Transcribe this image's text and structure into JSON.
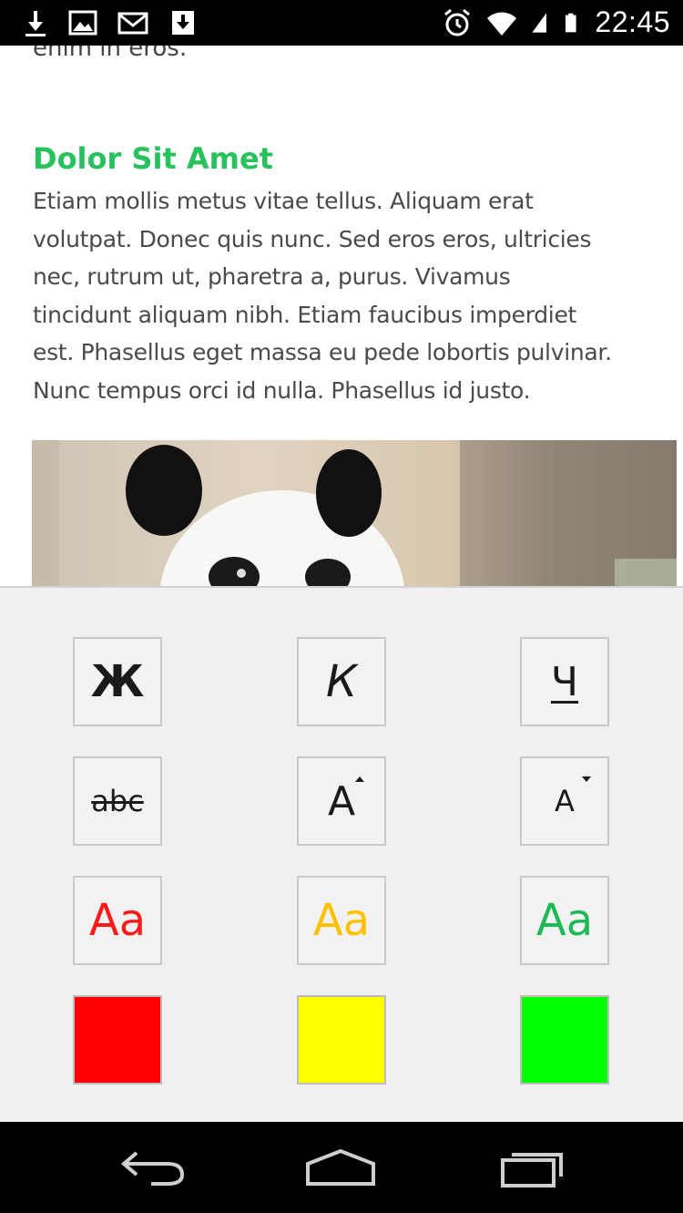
{
  "status_bar": {
    "time": "22:45",
    "left_icons": [
      "download-icon",
      "image-icon",
      "mail-icon",
      "file-download-icon"
    ],
    "right_icons": [
      "alarm-icon",
      "wifi-icon",
      "signal-icon",
      "battery-icon"
    ]
  },
  "article": {
    "cut_text": "enim in eros.",
    "heading": "Dolor Sit Amet",
    "heading_color": "#27c25d",
    "body_lines": [
      "Etiam mollis metus vitae tellus. Aliquam erat",
      "volutpat. Donec quis nunc. Sed eros eros, ultricies",
      "nec, rutrum ut, pharetra a, purus. Vivamus",
      "tincidunt aliquam nibh. Etiam faucibus imperdiet",
      "est. Phasellus eget massa eu pede lobortis pulvinar.",
      "Nunc tempus orci id nulla. Phasellus id justo."
    ]
  },
  "format_panel": {
    "bold_label": "Ж",
    "italic_label": "К",
    "underline_label": "Ч",
    "strike_label": "abc",
    "grow_label": "A",
    "shrink_label": "A",
    "text_color_label": "Aa",
    "colors": {
      "red": "#ff0000",
      "yellow": "#ffff00",
      "green": "#00ff00",
      "text_red": "#ff1a1a",
      "text_yellow": "#ffc000",
      "text_green": "#1db954"
    }
  },
  "nav_bar": {
    "icons": [
      "back-icon",
      "home-icon",
      "recents-icon"
    ]
  }
}
